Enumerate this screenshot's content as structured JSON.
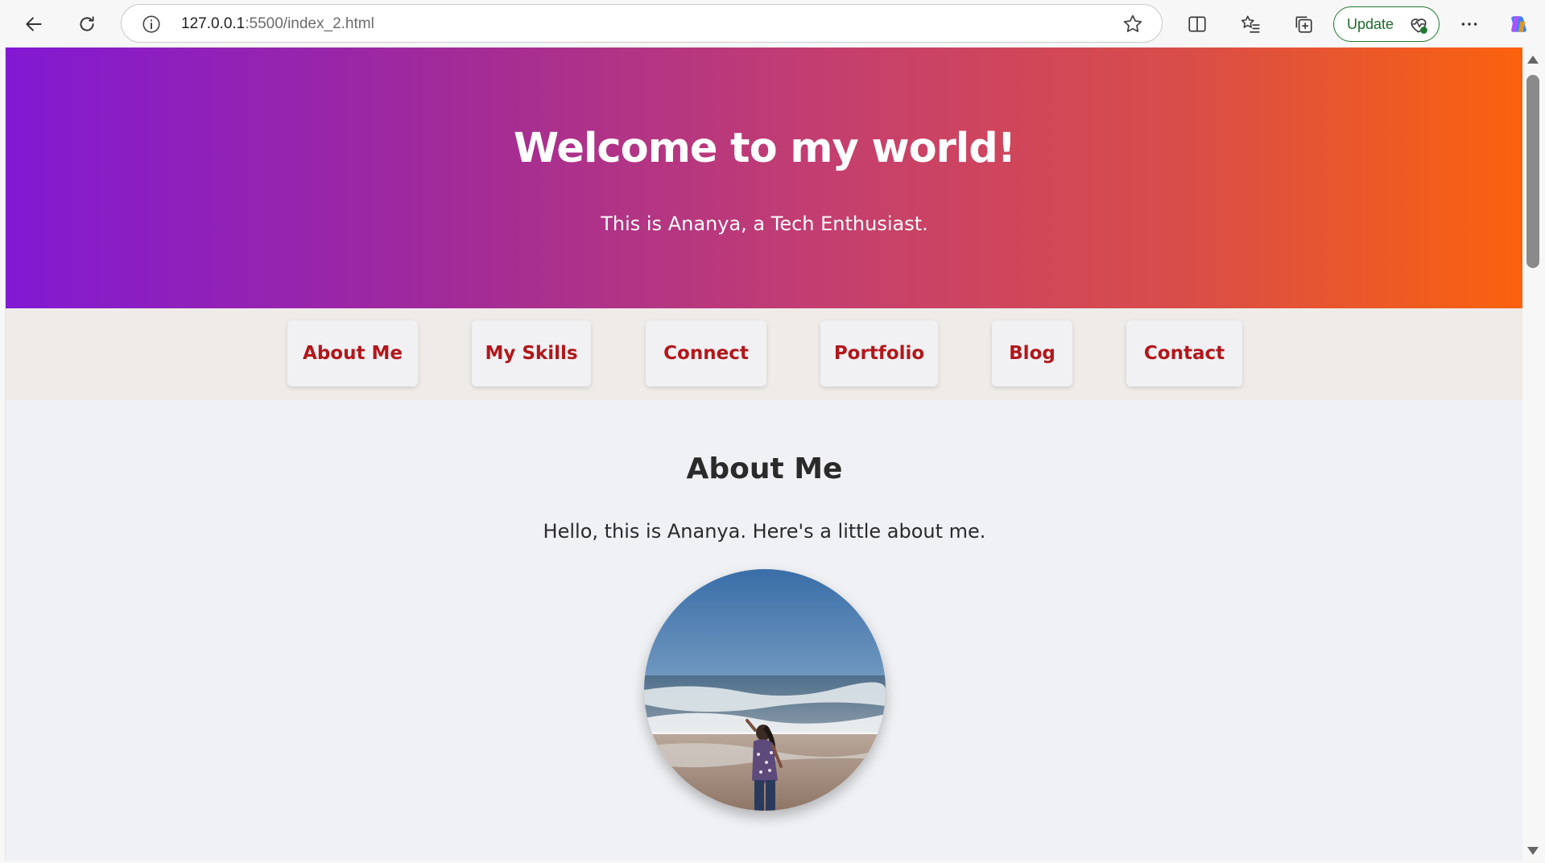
{
  "browser": {
    "url_host": "127.0.0.1",
    "url_rest": ":5500/index_2.html",
    "update_label": "Update",
    "icons": [
      "back-icon",
      "refresh-icon",
      "info-icon",
      "star-icon",
      "split-screen-icon",
      "favorites-icon",
      "collections-icon",
      "browser-health-icon",
      "more-icon",
      "copilot-icon"
    ]
  },
  "hero": {
    "title": "Welcome to my world!",
    "subtitle": "This is Ananya, a Tech Enthusiast.",
    "gradient": [
      "#8219d3",
      "#c53f6e",
      "#fb620d"
    ]
  },
  "nav": {
    "items": [
      {
        "label": "About Me"
      },
      {
        "label": "My Skills"
      },
      {
        "label": "Connect"
      },
      {
        "label": "Portfolio"
      },
      {
        "label": "Blog"
      },
      {
        "label": "Contact"
      }
    ],
    "link_color": "#b2171b"
  },
  "about": {
    "heading": "About Me",
    "text": "Hello, this is Ananya. Here's a little about me."
  }
}
